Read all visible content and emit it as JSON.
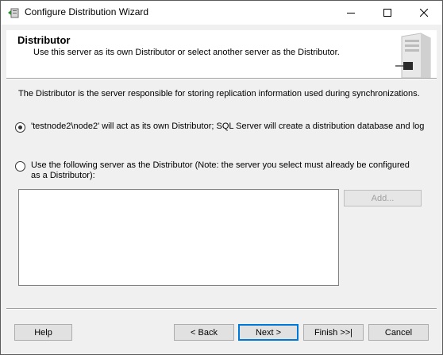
{
  "window": {
    "title": "Configure Distribution Wizard",
    "controls": {
      "minimize_icon": "minimize-icon",
      "maximize_icon": "maximize-icon",
      "close_icon": "close-icon"
    }
  },
  "header": {
    "title": "Distributor",
    "subtitle": "Use this server as its own Distributor or select another server as the Distributor."
  },
  "main": {
    "description": "The Distributor is the server responsible for storing replication information used during synchronizations.",
    "options": [
      {
        "label": "'testnode2\\node2' will act as its own Distributor; SQL Server will create a distribution database and log",
        "selected": true
      },
      {
        "label": "Use the following server as the Distributor (Note: the server you select must already be configured as a Distributor):",
        "selected": false
      }
    ],
    "server_list": [],
    "add_label": "Add..."
  },
  "footer": {
    "help": "Help",
    "back": "< Back",
    "next": "Next >",
    "finish": "Finish >>|",
    "cancel": "Cancel"
  },
  "colors": {
    "accent": "#0078d7",
    "window_bg": "#f0f0f0"
  }
}
